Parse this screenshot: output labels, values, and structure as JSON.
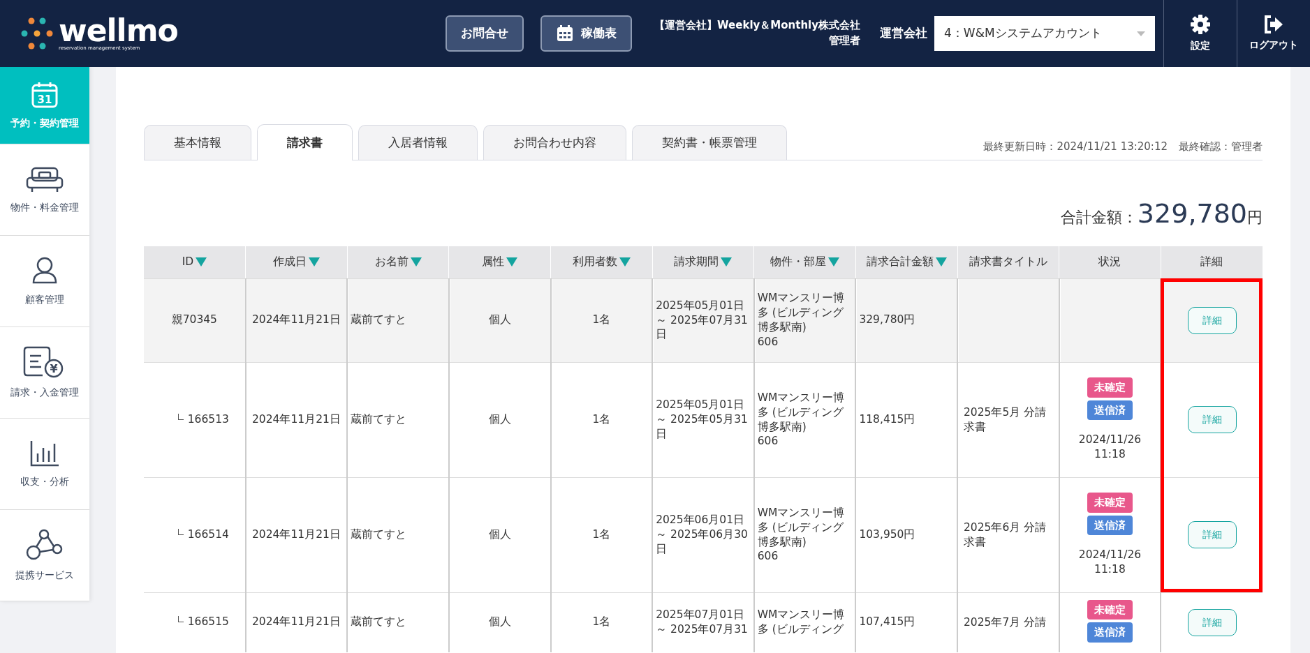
{
  "header": {
    "logo": {
      "name": "wellmo",
      "tagline": "reservation management system"
    },
    "buttons": [
      {
        "label": "お問合せ"
      },
      {
        "label": "稼働表"
      }
    ],
    "company": {
      "line1": "【運営会社】Weekly＆Monthly株式会社",
      "line2": "管理者"
    },
    "company_select": {
      "label": "運営会社",
      "value": "4：W&Mシステムアカウント"
    },
    "actions": [
      {
        "label": "設定"
      },
      {
        "label": "ログアウト"
      }
    ]
  },
  "sidebar": {
    "items": [
      {
        "label": "予約・契約管理",
        "icon_text": "31",
        "selected": true
      },
      {
        "label": "物件・料金管理",
        "selected": false
      },
      {
        "label": "顧客管理",
        "selected": false
      },
      {
        "label": "請求・入金管理",
        "icon_text": "¥",
        "selected": false
      },
      {
        "label": "収支・分析",
        "selected": false
      },
      {
        "label": "提携サービス",
        "selected": false
      }
    ]
  },
  "tabs": [
    {
      "label": "基本情報",
      "selected": false
    },
    {
      "label": "請求書",
      "selected": true
    },
    {
      "label": "入居者情報",
      "selected": false
    },
    {
      "label": "お問合わせ内容",
      "selected": false
    },
    {
      "label": "契約書・帳票管理",
      "selected": false
    }
  ],
  "last_updated": "最終更新日時：2024/11/21 13:20:12",
  "last_confirmed": "最終確認：管理者",
  "total": {
    "label": "合計金額：",
    "amount": "329,780",
    "unit": "円"
  },
  "table": {
    "columns": [
      {
        "label": "ID",
        "sortable": true
      },
      {
        "label": "作成日",
        "sortable": true
      },
      {
        "label": "お名前",
        "sortable": true
      },
      {
        "label": "属性",
        "sortable": true
      },
      {
        "label": "利用者数",
        "sortable": true
      },
      {
        "label": "請求期間",
        "sortable": true
      },
      {
        "label": "物件・部屋",
        "sortable": true
      },
      {
        "label": "請求合計金額",
        "sortable": true
      },
      {
        "label": "請求書タイトル",
        "sortable": false
      },
      {
        "label": "状況",
        "sortable": false
      },
      {
        "label": "詳細",
        "sortable": false
      }
    ],
    "rows": [
      {
        "kind": "parent",
        "id": "親70345",
        "created": "2024年11月21日",
        "name": "蔵前てすと",
        "attribute": "個人",
        "users": "1名",
        "period": [
          "2025年05月01日",
          "～ 2025年07月31",
          "日"
        ],
        "property": [
          "WMマンスリー博",
          "多 (ビルディング",
          "博多駅南)",
          "606"
        ],
        "amount": "329,780円",
        "title": [],
        "status": [],
        "status_date": [],
        "detail": "詳細",
        "highlighted": true
      },
      {
        "kind": "child",
        "id": "166513",
        "created": "2024年11月21日",
        "name": "蔵前てすと",
        "attribute": "個人",
        "users": "1名",
        "period": [
          "2025年05月01日",
          "～ 2025年05月31",
          "日"
        ],
        "property": [
          "WMマンスリー博",
          "多 (ビルディング",
          "博多駅南)",
          "606"
        ],
        "amount": "118,415円",
        "title": [
          "2025年5月 分請",
          "求書"
        ],
        "status": [
          {
            "label": "未確定",
            "color": "#e8578b"
          },
          {
            "label": "送信済",
            "color": "#4e86d8"
          }
        ],
        "status_date": [
          "2024/11/26",
          "11:18"
        ],
        "detail": "詳細",
        "highlighted": true
      },
      {
        "kind": "child",
        "id": "166514",
        "created": "2024年11月21日",
        "name": "蔵前てすと",
        "attribute": "個人",
        "users": "1名",
        "period": [
          "2025年06月01日",
          "～ 2025年06月30",
          "日"
        ],
        "property": [
          "WMマンスリー博",
          "多 (ビルディング",
          "博多駅南)",
          "606"
        ],
        "amount": "103,950円",
        "title": [
          "2025年6月 分請",
          "求書"
        ],
        "status": [
          {
            "label": "未確定",
            "color": "#e8578b"
          },
          {
            "label": "送信済",
            "color": "#4e86d8"
          }
        ],
        "status_date": [
          "2024/11/26",
          "11:18"
        ],
        "detail": "詳細",
        "highlighted": true
      },
      {
        "kind": "child",
        "id": "166515",
        "created": "2024年11月21日",
        "name": "蔵前てすと",
        "attribute": "個人",
        "users": "1名",
        "period": [
          "2025年07月01日",
          "～ 2025年07月31"
        ],
        "property": [
          "WMマンスリー博",
          "多 (ビルディング"
        ],
        "amount": "107,415円",
        "title": [
          "2025年7月 分請"
        ],
        "status": [
          {
            "label": "未確定",
            "color": "#e8578b"
          },
          {
            "label": "送信済",
            "color": "#4e86d8"
          }
        ],
        "status_date": [],
        "detail": "詳細",
        "highlighted": false
      }
    ]
  }
}
